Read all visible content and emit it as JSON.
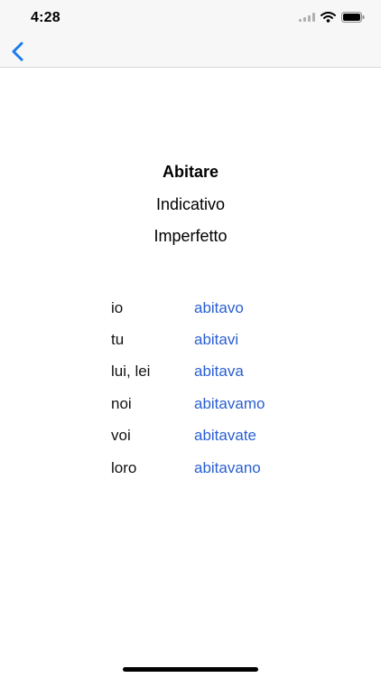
{
  "status_bar": {
    "time": "4:28",
    "icons": [
      "signal-icon",
      "wifi-icon",
      "battery-icon"
    ]
  },
  "nav": {
    "back_icon": "chevron-left-icon",
    "accent": "#1a7cf0"
  },
  "verb": {
    "infinitive": "Abitare",
    "mode": "Indicativo",
    "tense": "Imperfetto"
  },
  "conjugation": [
    {
      "pronoun": "io",
      "form": "abitavo"
    },
    {
      "pronoun": "tu",
      "form": "abitavi"
    },
    {
      "pronoun": "lui, lei",
      "form": "abitava"
    },
    {
      "pronoun": "noi",
      "form": "abitavamo"
    },
    {
      "pronoun": "voi",
      "form": "abitavate"
    },
    {
      "pronoun": "loro",
      "form": "abitavano"
    }
  ],
  "colors": {
    "form_text": "#2a5fd1",
    "bar_background": "#f7f7f7"
  }
}
